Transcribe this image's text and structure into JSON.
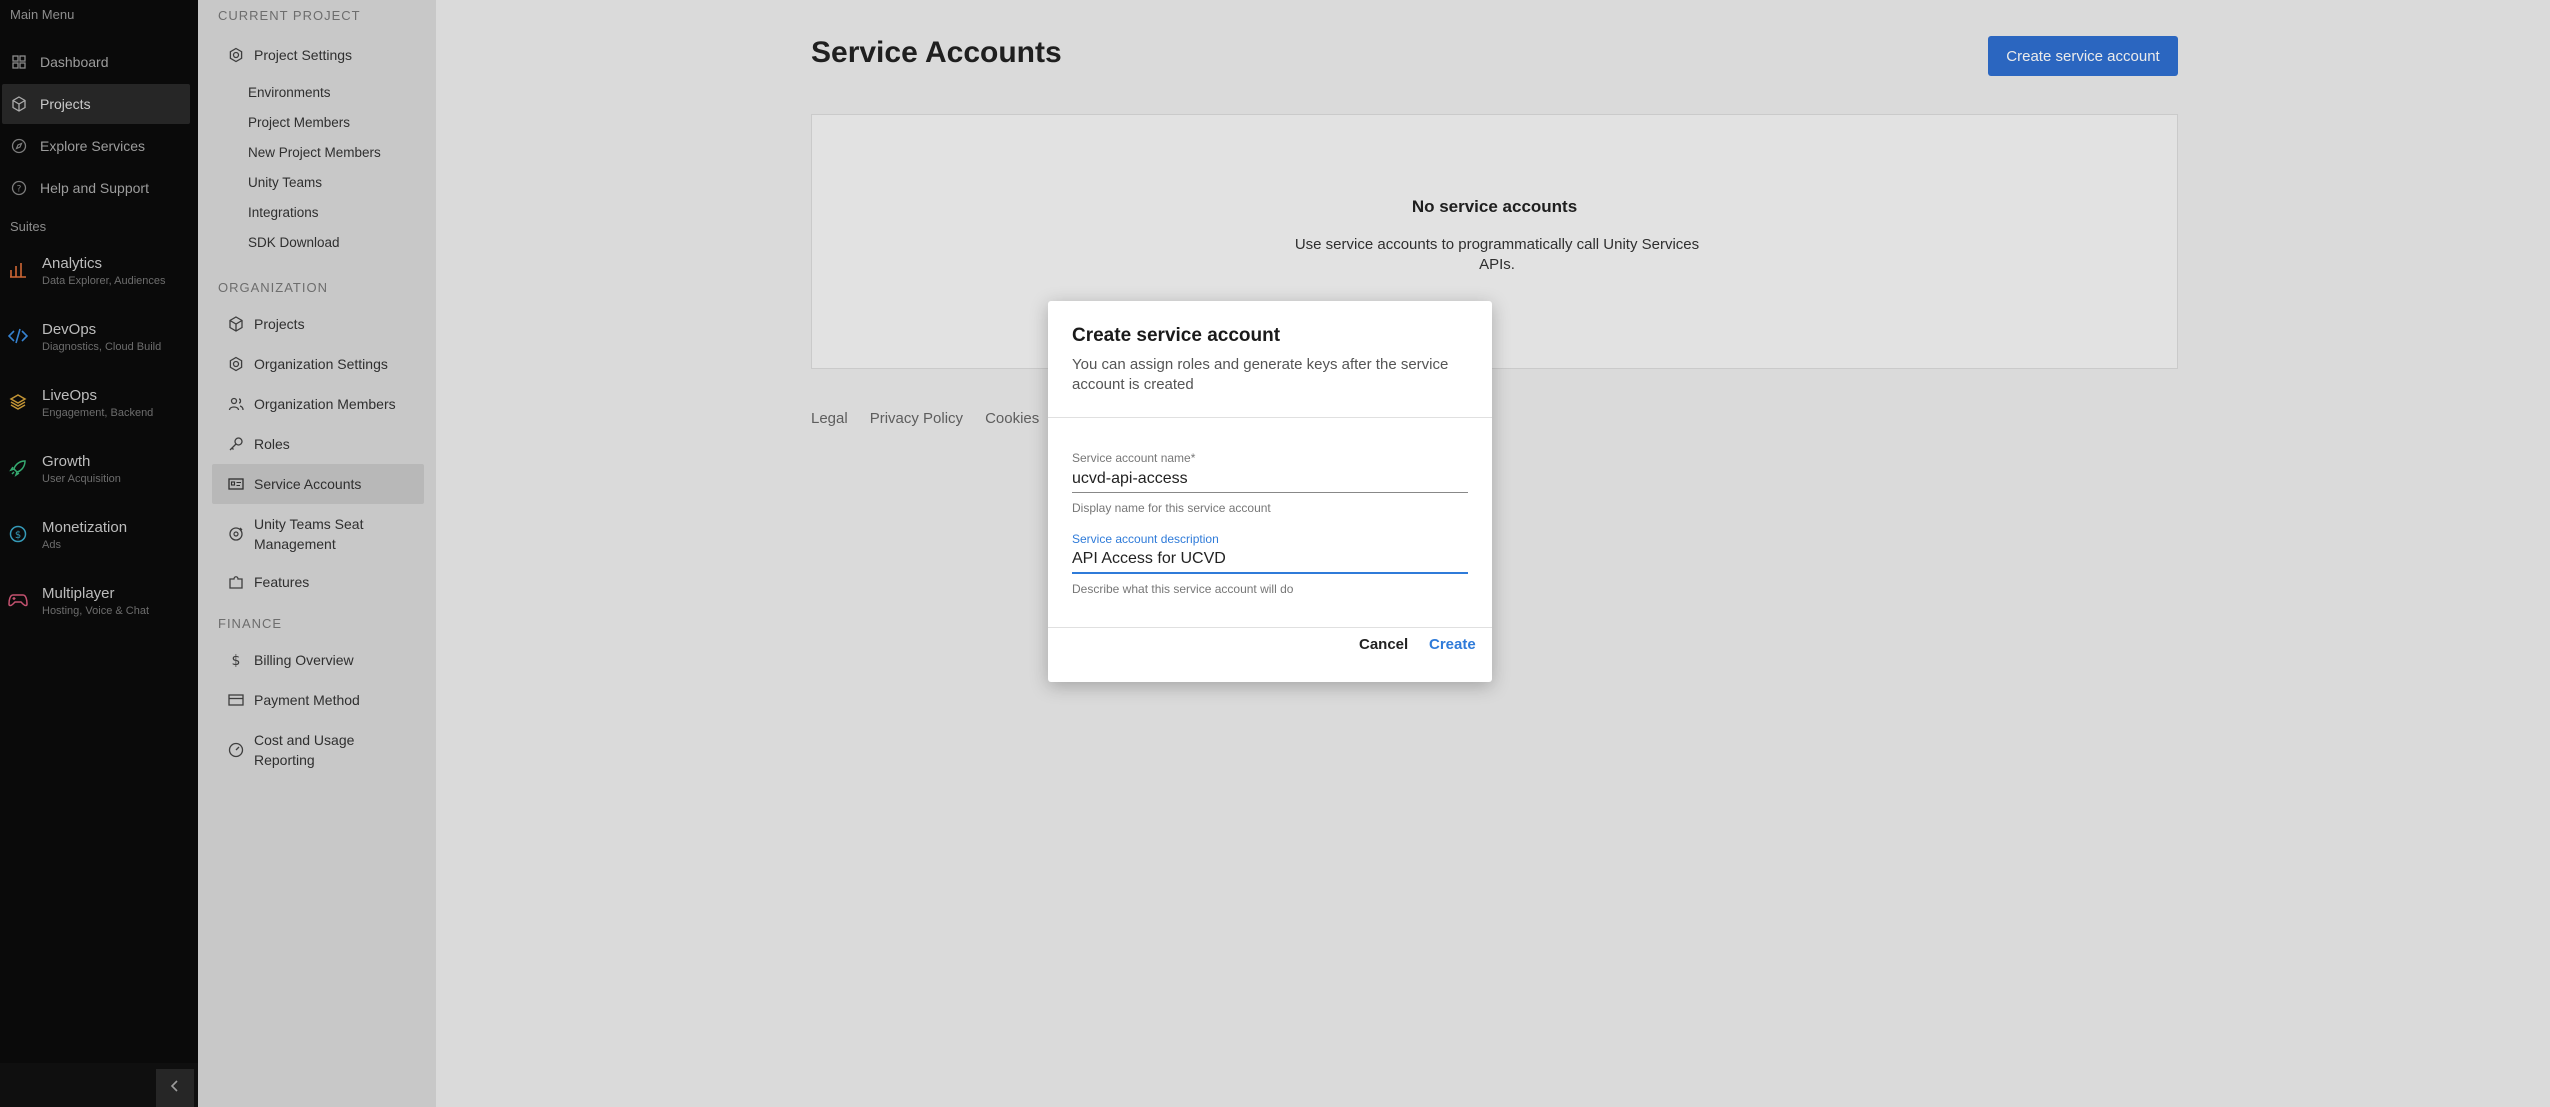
{
  "nav": {
    "main_menu_label": "Main Menu",
    "items": [
      {
        "label": "Dashboard",
        "icon": "dashboard-icon"
      },
      {
        "label": "Projects",
        "icon": "cube-icon"
      },
      {
        "label": "Explore Services",
        "icon": "compass-icon"
      },
      {
        "label": "Help and Support",
        "icon": "help-icon"
      }
    ],
    "suites_label": "Suites",
    "suites": [
      {
        "name": "Analytics",
        "sub": "Data Explorer, Audiences",
        "color": "#e2703a"
      },
      {
        "name": "DevOps",
        "sub": "Diagnostics, Cloud Build",
        "color": "#3a8ee2"
      },
      {
        "name": "LiveOps",
        "sub": "Engagement, Backend",
        "color": "#d4a23a"
      },
      {
        "name": "Growth",
        "sub": "User Acquisition",
        "color": "#3ab87a"
      },
      {
        "name": "Monetization",
        "sub": "Ads",
        "color": "#3aa8c8"
      },
      {
        "name": "Multiplayer",
        "sub": "Hosting, Voice & Chat",
        "color": "#d65a7a"
      }
    ]
  },
  "subnav": {
    "current_project_label": "Current Project",
    "project_settings": "Project Settings",
    "project_sub": [
      "Environments",
      "Project Members",
      "New Project Members",
      "Unity Teams",
      "Integrations",
      "SDK Download"
    ],
    "organization_label": "Organization",
    "org_items": [
      "Projects",
      "Organization Settings",
      "Organization Members",
      "Roles",
      "Service Accounts",
      "Unity Teams Seat Management",
      "Features"
    ],
    "finance_label": "Finance",
    "finance_items": [
      "Billing Overview",
      "Payment Method",
      "Cost and Usage Reporting"
    ]
  },
  "main": {
    "title": "Service Accounts",
    "create_button": "Create service account",
    "empty_title": "No service accounts",
    "empty_desc": "Use service accounts to programmatically call Unity Services APIs.",
    "footer": [
      "Legal",
      "Privacy Policy",
      "Cookies"
    ]
  },
  "modal": {
    "title": "Create service account",
    "subtitle": "You can assign roles and generate keys after the service account is created",
    "name_label": "Service account name*",
    "name_value": "ucvd-api-access",
    "name_help": "Display name for this service account",
    "desc_label": "Service account description",
    "desc_value": "API Access for UCVD",
    "desc_help": "Describe what this service account will do",
    "cancel": "Cancel",
    "create": "Create"
  },
  "colors": {
    "accent": "#2f7bd9",
    "primary_button": "#2f6fd1"
  }
}
